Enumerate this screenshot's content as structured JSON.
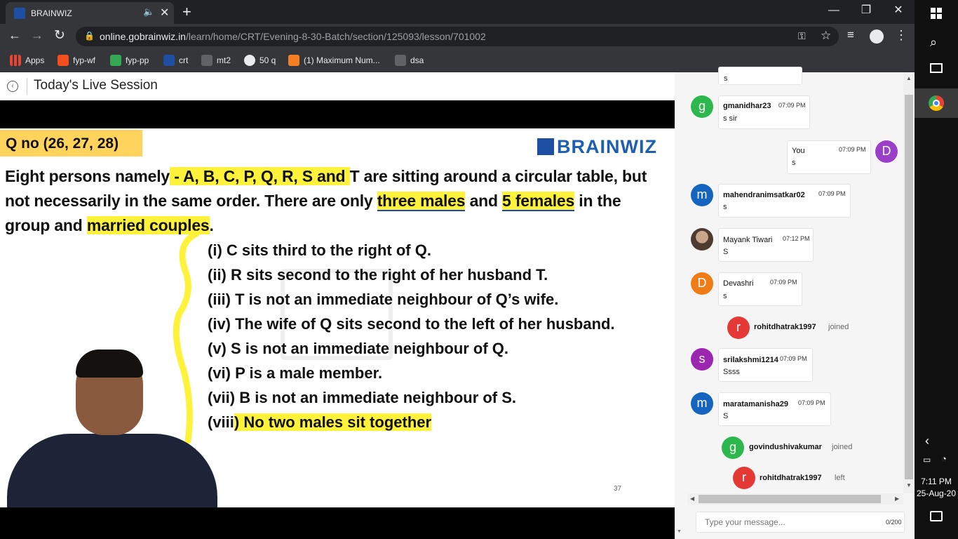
{
  "browser": {
    "tab_title": "BRAINWIZ",
    "url_host": "online.gobrainwiz.in",
    "url_path": "/learn/home/CRT/Evening-8-30-Batch/section/125093/lesson/701002",
    "bookmarks": [
      "Apps",
      "fyp-wf",
      "fyp-pp",
      "crt",
      "mt2",
      "50 q",
      "(1) Maximum Num...",
      "dsa"
    ]
  },
  "page": {
    "title": "Today's Live Session"
  },
  "slide": {
    "q_label": "Q no (26, 27, 28)",
    "logo": "BRAINWIZ",
    "line1_a": "Eight persons namely",
    "line1_b": " - A, B, C, P, Q, R, S and ",
    "line1_c": "T are sitting around a circular table, but",
    "line2_a": "not necessarily in the same order. There are only ",
    "line2_b": "three males",
    "line2_c": " and ",
    "line2_d": "5 females",
    "line2_e": " in the",
    "line3_a": "group and ",
    "line3_b": "married couples",
    "line3_c": ".",
    "statements": [
      "(i)  C sits third to the right of Q.",
      "(ii) R sits second to the right of her husband T.",
      "(iii) T is not an immediate neighbour of Q’s wife.",
      "(iv) The wife of Q sits second to the left of her husband.",
      "(v) S is not an immediate neighbour of Q.",
      "(vi) P is a male member.",
      "(vii) B is not an immediate neighbour of S."
    ],
    "last_prefix": "(viii",
    "last_hl": ") No two males sit together",
    "page_no": "37"
  },
  "chat": {
    "top_partial": "s",
    "messages": [
      {
        "user": "gmanidhar23",
        "time": "07:09 PM",
        "text": "s sir",
        "avatar": "g",
        "color": "#2db84d"
      },
      {
        "user": "You",
        "time": "07:09 PM",
        "text": "s",
        "avatar": "D",
        "color": "#9b3fc8"
      },
      {
        "user": "mahendranimsatkar02",
        "time": "07:09 PM",
        "text": "s",
        "avatar": "m",
        "color": "#1565c0"
      },
      {
        "user": "Mayank Tiwari",
        "time": "07:12 PM",
        "text": "S",
        "avatar": "",
        "color": "#6d5548"
      },
      {
        "user": "Devashri",
        "time": "07:09 PM",
        "text": "s",
        "avatar": "D",
        "color": "#ef7c17"
      },
      {
        "user": "srilakshmi1214",
        "time": "07:09 PM",
        "text": "Ssss",
        "avatar": "s",
        "color": "#9b27b0"
      },
      {
        "user": "maratamanisha29",
        "time": "07:09 PM",
        "text": "S",
        "avatar": "m",
        "color": "#1565c0"
      }
    ],
    "events": [
      {
        "user": "rohitdhatrak1997",
        "action": "joined",
        "avatar": "r",
        "color": "#e53935"
      },
      {
        "user": "govindushivakumar",
        "action": "joined",
        "avatar": "g",
        "color": "#2db84d"
      },
      {
        "user": "rohitdhatrak1997",
        "action": "left",
        "avatar": "r",
        "color": "#e53935"
      }
    ],
    "input_placeholder": "Type your message...",
    "char_count": "0/200"
  },
  "taskbar": {
    "time": "7:11 PM",
    "date": "25-Aug-20"
  }
}
